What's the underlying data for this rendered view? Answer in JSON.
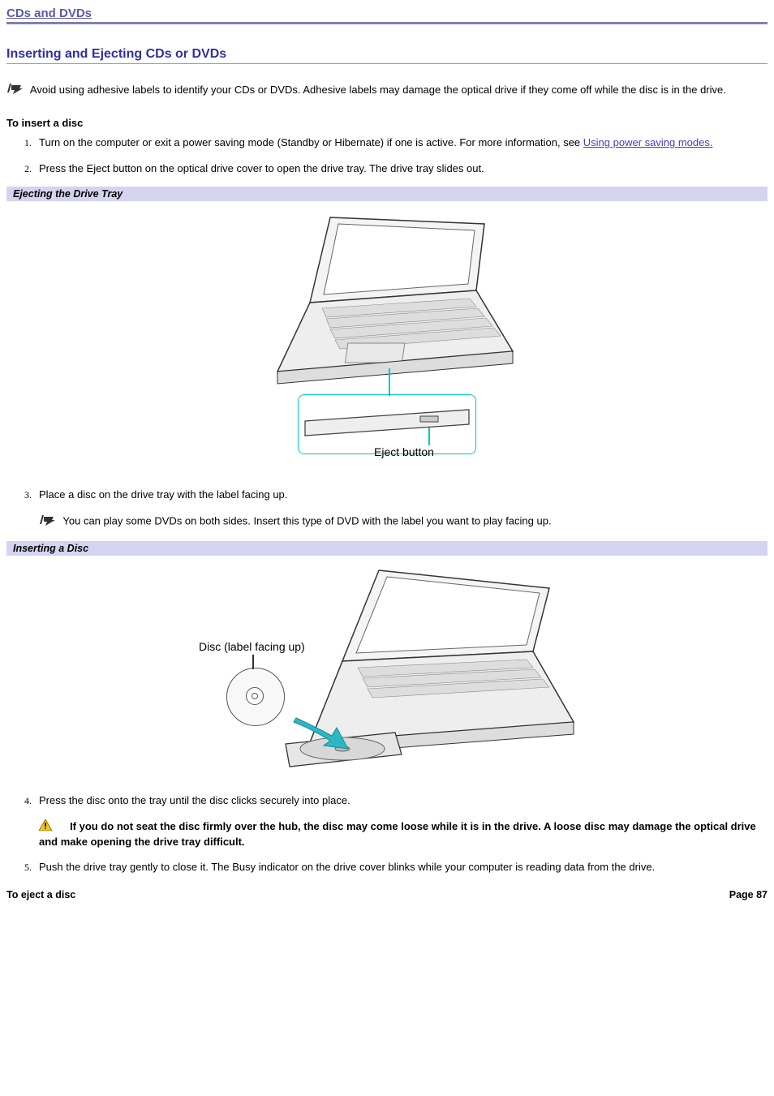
{
  "breadcrumb": "CDs and DVDs",
  "section_title": "Inserting and Ejecting CDs or DVDs",
  "note1": "Avoid using adhesive labels to identify your CDs or DVDs. Adhesive labels may damage the optical drive if they come off while the disc is in the drive.",
  "insert_heading": "To insert a disc",
  "steps": {
    "s1a": "Turn on the computer or exit a power saving mode (Standby or Hibernate) if one is active. For more information, see ",
    "s1_link": "Using power saving modes.",
    "s2": "Press the Eject button on the optical drive cover to open the drive tray. The drive tray slides out.",
    "s3": "Place a disc on the drive tray with the label facing up.",
    "s3_note": "You can play some DVDs on both sides. Insert this type of DVD with the label you want to play facing up.",
    "s4": "Press the disc onto the tray until the disc clicks securely into place.",
    "s4_warn": "If you do not seat the disc firmly over the hub, the disc may come loose while it is in the drive. A loose disc may damage the optical drive and make opening the drive tray difficult.",
    "s5": "Push the drive tray gently to close it. The Busy indicator on the drive cover blinks while your computer is reading data from the drive."
  },
  "fig1_caption": "Ejecting the Drive Tray",
  "fig1_label": "Eject button",
  "fig2_caption": "Inserting a Disc",
  "fig2_label": "Disc (label facing up)",
  "eject_heading": "To eject a disc",
  "page_label": "Page 87"
}
